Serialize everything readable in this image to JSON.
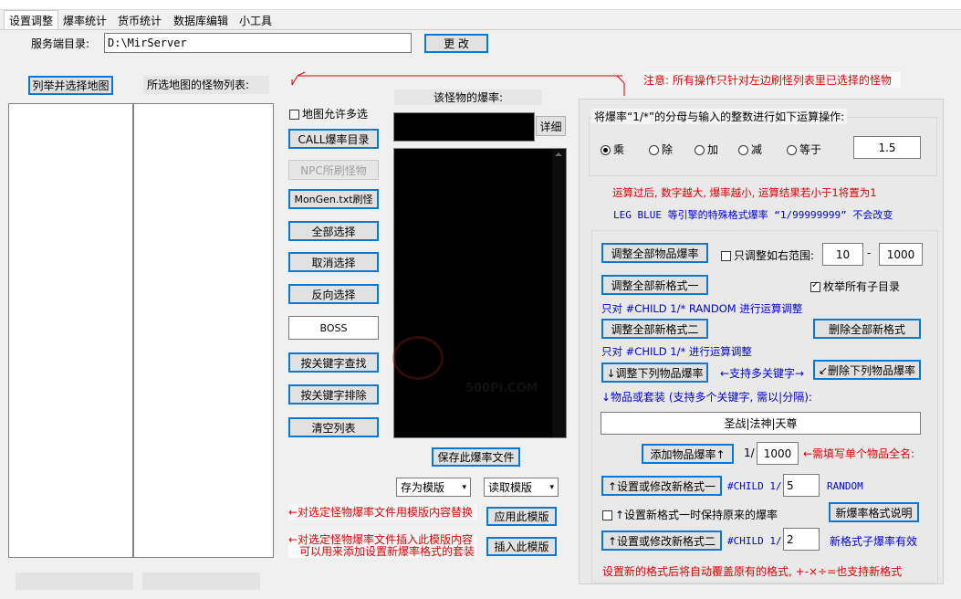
{
  "tabs": [
    "设置调整",
    "爆率统计",
    "货币统计",
    "数据库编辑",
    "小工具"
  ],
  "server_dir": {
    "label": "服务端目录:",
    "value": "D:\\MirServer",
    "change_button": "更 改"
  },
  "left": {
    "list_maps_button": "列举并选择地图",
    "monster_list_label": "所选地图的怪物列表:"
  },
  "middle": {
    "allow_multi_map": "地图允许多选",
    "buttons": [
      "CALL爆率目录",
      "NPC所刷怪物",
      "MonGen.txt刷怪",
      "全部选择",
      "取消选择",
      "反向选择"
    ],
    "boss_field": "BOSS",
    "search_buttons": [
      "按关键字查找",
      "按关键字排除",
      "清空列表"
    ],
    "drop_rate_label": "该怪物的爆率:",
    "detail_button": "详细",
    "save_button": "保存此爆率文件",
    "save_template": "存为模版",
    "read_template": "读取模版",
    "apply_note": "←对选定怪物爆率文件用模版内容替换",
    "apply_button": "应用此模版",
    "insert_note_1": "←对选定怪物爆率文件插入此模版内容",
    "insert_note_2": "可以用来添加设置新爆率格式的套装",
    "insert_button": "插入此模版"
  },
  "notice": "注意: 所有操作只针对左边刷怪列表里已选择的怪物",
  "right": {
    "op_title": "将爆率“1/*”的分母与输入的整数进行如下运算操作:",
    "ops": [
      "乘",
      "除",
      "加",
      "减",
      "等于"
    ],
    "op_value": "1.5",
    "hint_red": "运算过后, 数字越大, 爆率越小, 运算结果若小于1将置为1",
    "hint_blue": "LEG BLUE 等引擎的特殊格式爆率 “1/99999999” 不会改变",
    "adjust_all_button": "调整全部物品爆率",
    "range_check": "只调整如右范围:",
    "range_from": "10",
    "range_to": "1000",
    "adjust_new1_button": "调整全部新格式一",
    "enum_subdirs": "枚举所有子目录",
    "note_child_random": "只对 #CHILD 1/* RANDOM 进行运算调整",
    "adjust_new2_button": "调整全部新格式二",
    "delete_new_button": "删除全部新格式",
    "note_child": "只对 #CHILD 1/* 进行运算调整",
    "adjust_below_button": "↓调整下列物品爆率",
    "multi_keyword": "←支持多关键字→",
    "delete_below_button": "↙删除下列物品爆率",
    "item_hint": "↓物品或套装 (支持多个关键字, 需以|分隔):",
    "item_value": "圣战|法神|天尊",
    "add_item_button": "添加物品爆率↑",
    "add_prefix": "1/",
    "add_value": "1000",
    "add_note": "←需填写单个物品全名:",
    "set_new1_button": "↑设置或修改新格式一",
    "child_prefix": "#CHILD 1/",
    "new1_value": "5",
    "random_label": "RANDOM",
    "keep_original": "↑设置新格式一时保持原来的爆率",
    "new_format_help": "新爆率格式说明",
    "set_new2_button": "↑设置或修改新格式二",
    "new2_value": "2",
    "new2_note": "新格式子爆率有效",
    "bottom_note": "设置新的格式后将自动覆盖原有的格式, +-×÷=也支持新格式"
  },
  "watermark": {
    "text": "500Pi.COM"
  },
  "colors": {
    "accent": "#0078d7",
    "red": "#e00000",
    "blue": "#0000e6"
  }
}
